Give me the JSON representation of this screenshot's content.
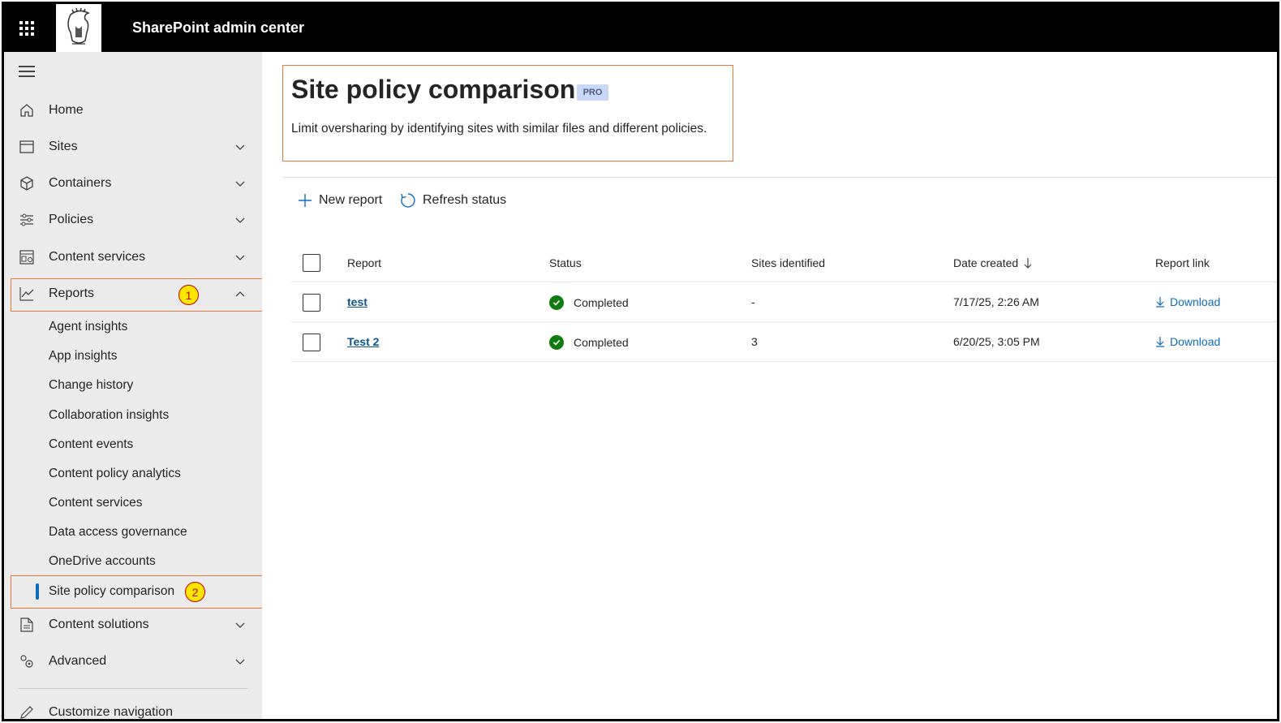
{
  "app": {
    "title": "SharePoint admin center"
  },
  "sidebar": {
    "items": [
      {
        "label": "Home",
        "icon": "home-icon"
      },
      {
        "label": "Sites",
        "icon": "sites-icon"
      },
      {
        "label": "Containers",
        "icon": "cube-icon"
      },
      {
        "label": "Policies",
        "icon": "sliders-icon"
      },
      {
        "label": "Content services",
        "icon": "content-services-icon"
      },
      {
        "label": "Reports",
        "icon": "chart-line-icon"
      }
    ],
    "reports_subitems": [
      "Agent insights",
      "App insights",
      "Change history",
      "Collaboration insights",
      "Content events",
      "Content policy analytics",
      "Content services",
      "Data access governance",
      "OneDrive accounts",
      "Site policy comparison"
    ],
    "bottom_items": [
      {
        "label": "Content solutions",
        "icon": "document-icon"
      },
      {
        "label": "Advanced",
        "icon": "gears-icon"
      }
    ],
    "customize_label": "Customize navigation",
    "callout_1": "1",
    "callout_2": "2"
  },
  "page": {
    "title": "Site policy comparison",
    "badge": "PRO",
    "subtitle": "Limit oversharing by identifying sites with similar files and different policies."
  },
  "toolbar": {
    "new_report": "New report",
    "refresh_status": "Refresh status"
  },
  "table": {
    "columns": [
      "Report",
      "Status",
      "Sites identified",
      "Date created",
      "Report link"
    ],
    "rows": [
      {
        "report": "test",
        "status": "Completed",
        "sites": "-",
        "date": "7/17/25, 2:26 AM",
        "link": "Download"
      },
      {
        "report": "Test 2",
        "status": "Completed",
        "sites": "3",
        "date": "6/20/25, 3:05 PM",
        "link": "Download"
      }
    ]
  },
  "colors": {
    "accent": "#0f6cbd",
    "callout": "#e9763b",
    "success": "#107c10",
    "topbar": "#000000",
    "sidebar": "#ebebeb"
  }
}
